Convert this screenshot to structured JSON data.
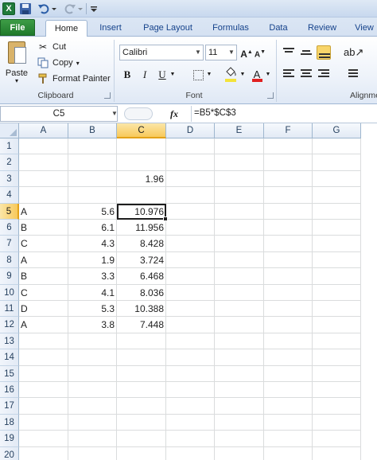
{
  "qat": {
    "app_icon_letter": "X"
  },
  "tabs": [
    {
      "label": "File"
    },
    {
      "label": "Home"
    },
    {
      "label": "Insert"
    },
    {
      "label": "Page Layout"
    },
    {
      "label": "Formulas"
    },
    {
      "label": "Data"
    },
    {
      "label": "Review"
    },
    {
      "label": "View"
    }
  ],
  "ribbon": {
    "clipboard": {
      "paste_label": "Paste",
      "cut_label": "Cut",
      "copy_label": "Copy",
      "format_painter_label": "Format Painter",
      "group_label": "Clipboard"
    },
    "font": {
      "font_name": "Calibri",
      "font_size": "11",
      "group_label": "Font",
      "fill_color": "#f3e33a",
      "font_color": "#e02020"
    },
    "alignment": {
      "group_label": "Alignme"
    }
  },
  "formula_bar": {
    "name_box": "C5",
    "fx_label": "fx",
    "formula": "=B5*$C$3"
  },
  "sheet": {
    "columns": [
      "A",
      "B",
      "C",
      "D",
      "E",
      "F",
      "G"
    ],
    "rows": [
      "1",
      "2",
      "3",
      "4",
      "5",
      "6",
      "7",
      "8",
      "9",
      "10",
      "11",
      "12",
      "13",
      "14",
      "15",
      "16",
      "17",
      "18",
      "19",
      "20"
    ],
    "active_cell": "C5",
    "cells": {
      "C3": "1.96",
      "A5": "A",
      "B5": "5.6",
      "C5": "10.976",
      "A6": "B",
      "B6": "6.1",
      "C6": "11.956",
      "A7": "C",
      "B7": "4.3",
      "C7": "8.428",
      "A8": "A",
      "B8": "1.9",
      "C8": "3.724",
      "A9": "B",
      "B9": "3.3",
      "C9": "6.468",
      "A10": "C",
      "B10": "4.1",
      "C10": "8.036",
      "A11": "D",
      "B11": "5.3",
      "C11": "10.388",
      "A12": "A",
      "B12": "3.8",
      "C12": "7.448"
    }
  },
  "colors": {
    "file_tab": "#2a8a36",
    "selection_header": "#f8c95b"
  }
}
